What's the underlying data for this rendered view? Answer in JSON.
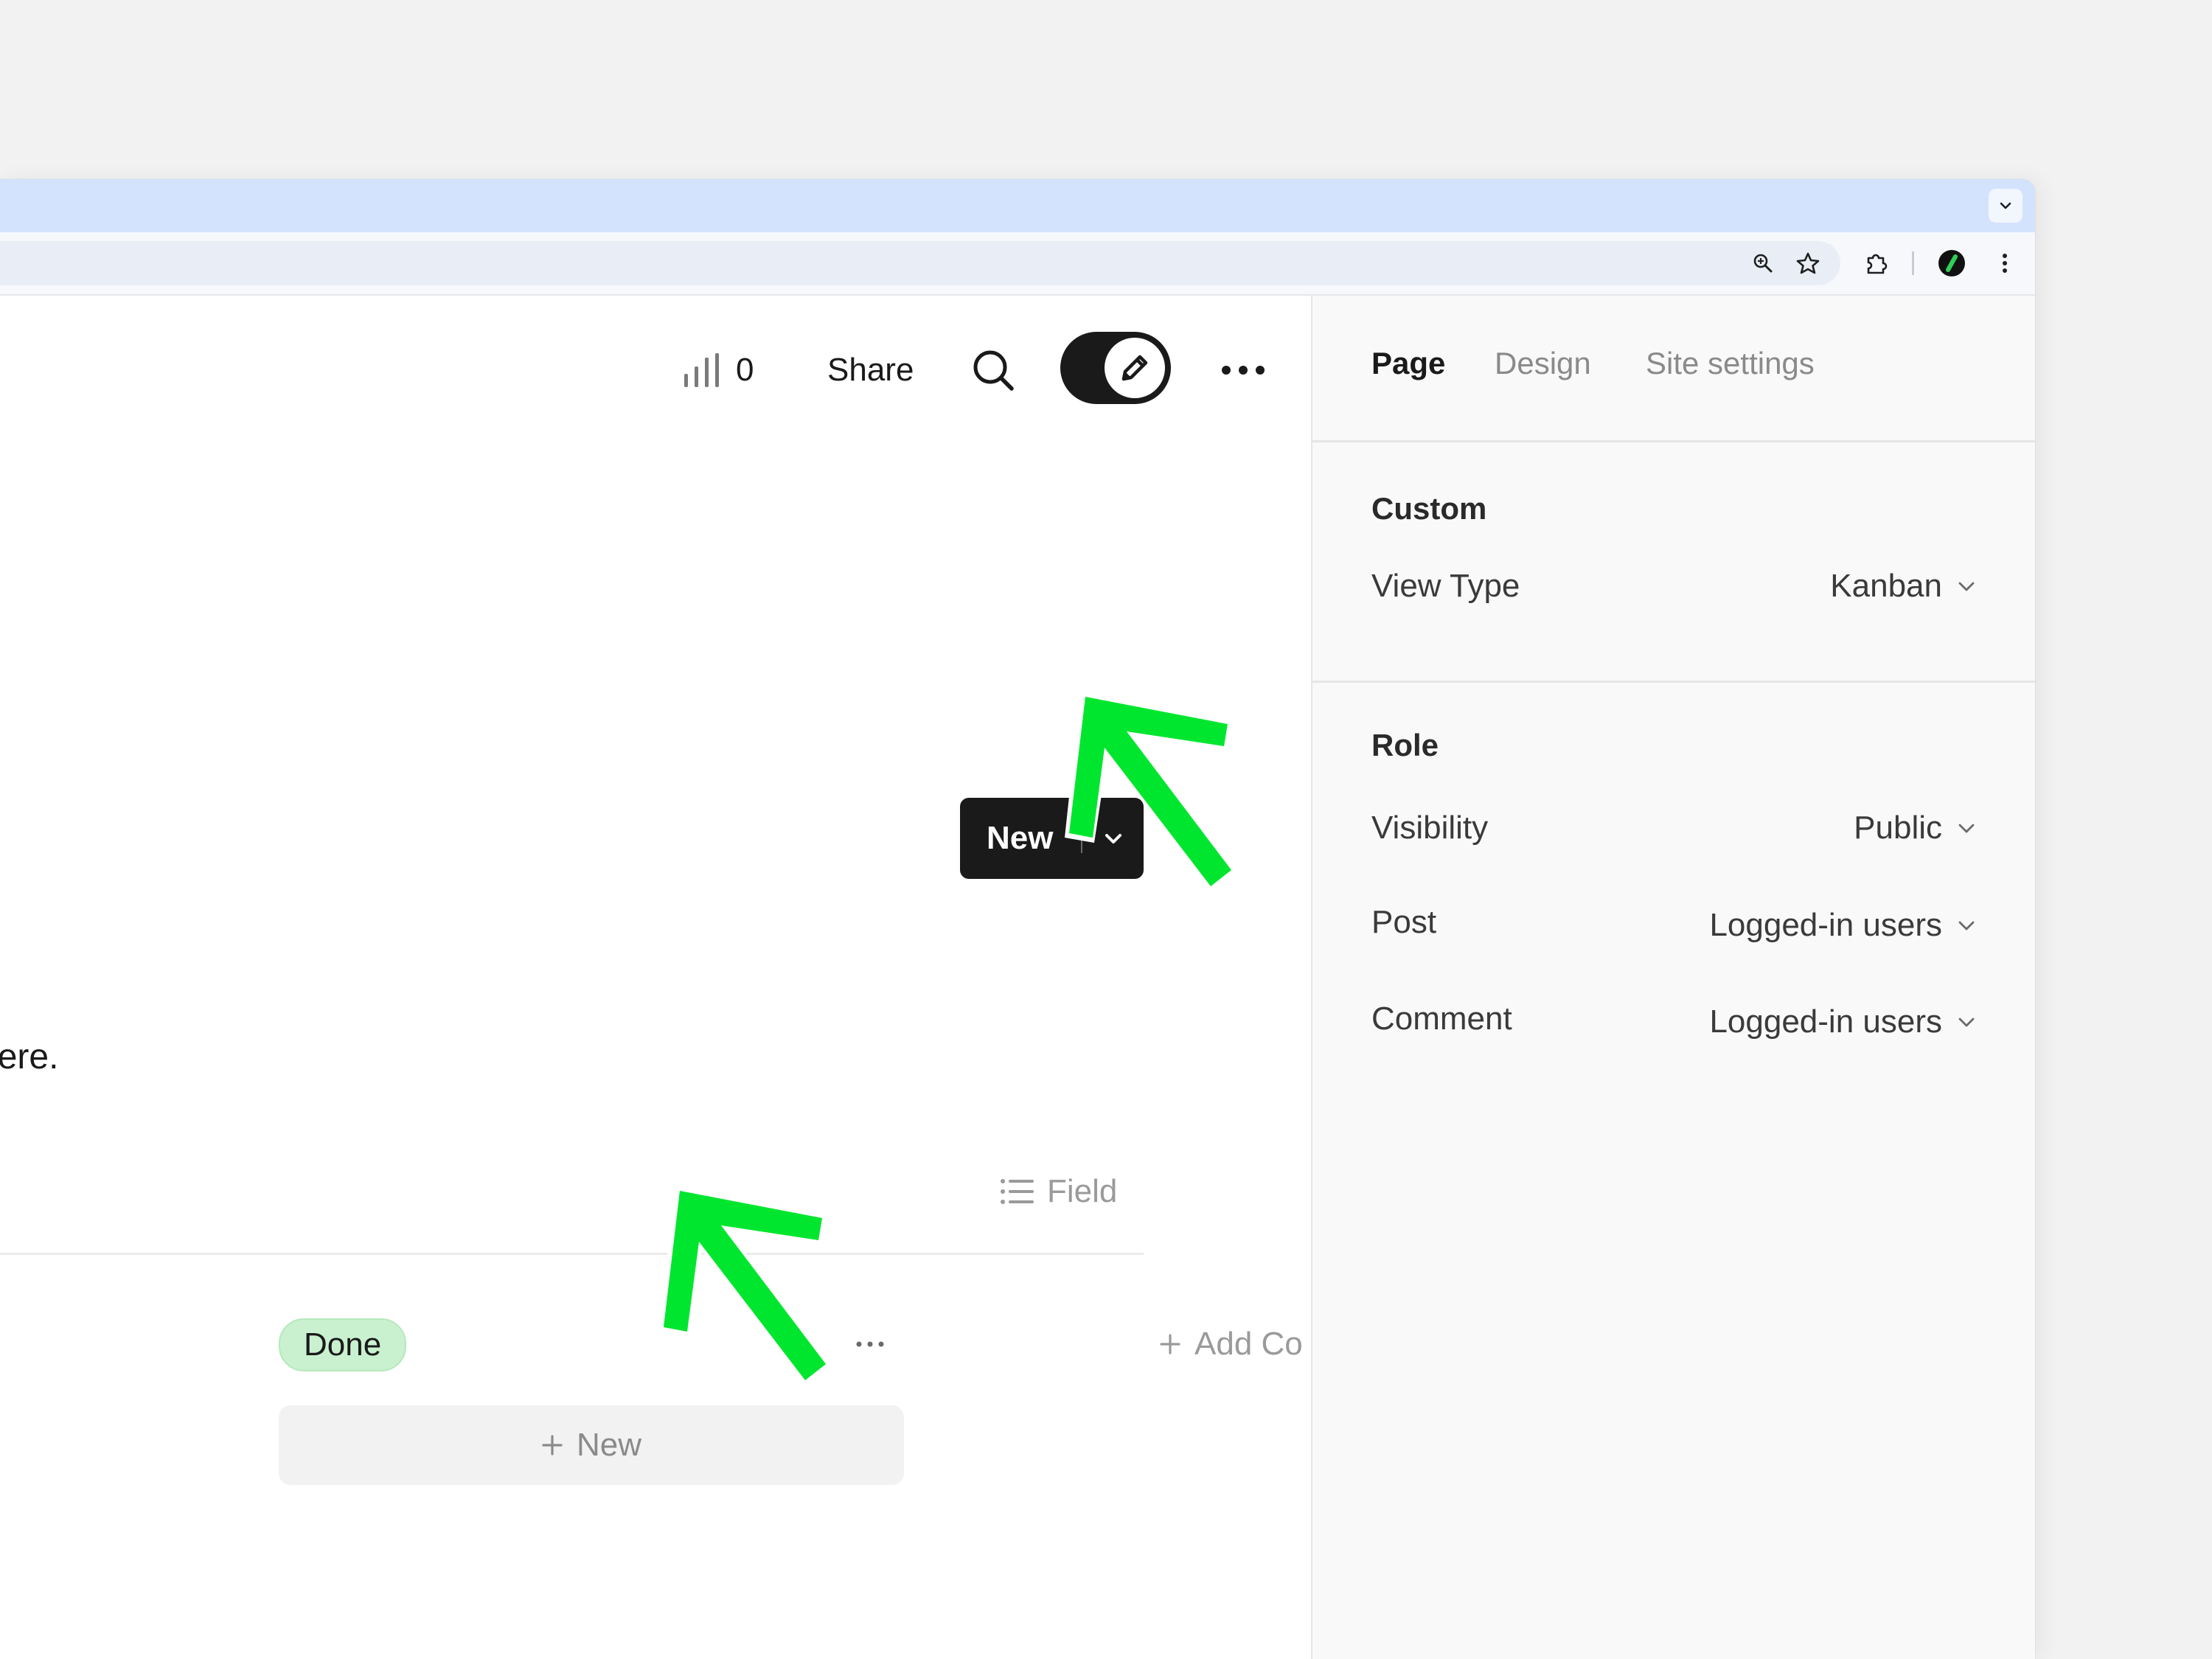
{
  "page": {
    "view_count": "0",
    "share_label": "Share",
    "new_button_label": "New",
    "description_text": "here.",
    "field_label": "Field"
  },
  "board": {
    "column_status": "Done",
    "new_card_label": "New",
    "add_column_label": "Add Co"
  },
  "panel": {
    "tabs": [
      "Page",
      "Design",
      "Site settings"
    ],
    "active_tab": "Page",
    "custom": {
      "title": "Custom",
      "view_type_label": "View Type",
      "view_type_value": "Kanban"
    },
    "role": {
      "title": "Role",
      "visibility_label": "Visibility",
      "visibility_value": "Public",
      "post_label": "Post",
      "post_value": "Logged-in users",
      "comment_label": "Comment",
      "comment_value": "Logged-in users"
    }
  },
  "colors": {
    "browser_tabstrip": "#d3e3fd",
    "primary_button": "#1a1a1a",
    "status_tag": "#c9f1cf",
    "annotation_arrow": "#00e62e"
  },
  "icons": {
    "stats": "bar-chart-icon",
    "search": "search-icon",
    "edit_toggle": "pencil-icon",
    "more": "more-horizontal-icon",
    "zoom": "zoom-icon",
    "bookmark": "star-icon",
    "extensions": "puzzle-icon",
    "profile": "profile-icon"
  }
}
